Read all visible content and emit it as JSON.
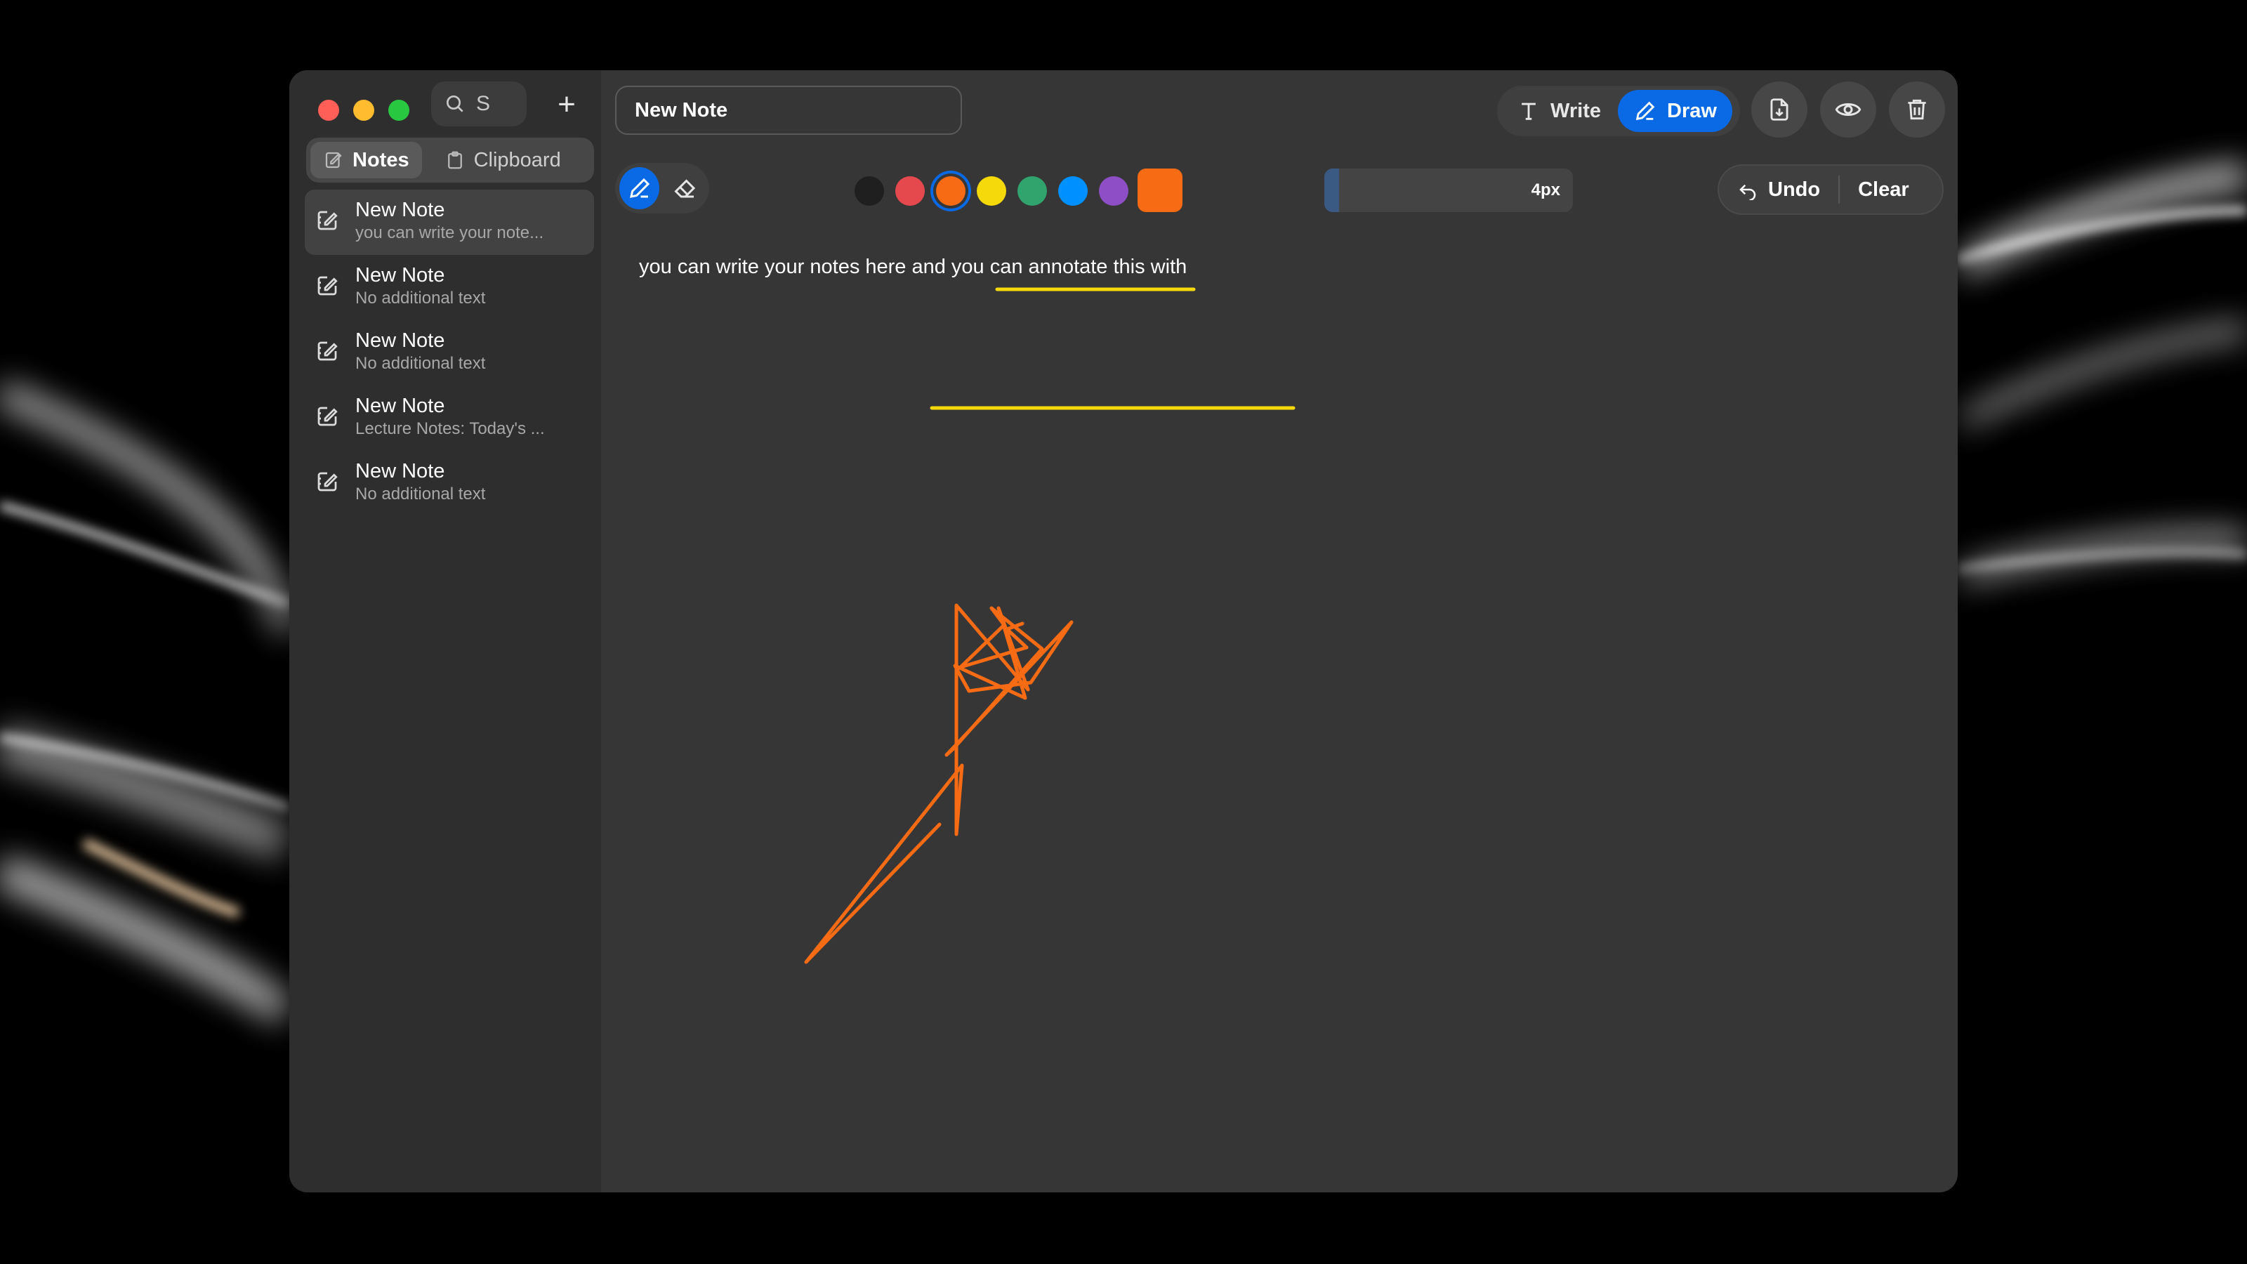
{
  "sidebar": {
    "search": {
      "value": "S"
    },
    "add_label": "+",
    "tabs": [
      {
        "label": "Notes",
        "icon": "notes-icon"
      },
      {
        "label": "Clipboard",
        "icon": "clipboard-icon"
      }
    ],
    "notes": [
      {
        "title": "New Note",
        "subtitle": "you can write your note..."
      },
      {
        "title": "New Note",
        "subtitle": "No additional text"
      },
      {
        "title": "New Note",
        "subtitle": "No additional text"
      },
      {
        "title": "New Note",
        "subtitle": "Lecture Notes: Today's ..."
      },
      {
        "title": "New Note",
        "subtitle": "No additional text"
      }
    ]
  },
  "editor": {
    "title": "New Note",
    "body_text": "you can write your notes here and you can annotate this with",
    "mode": {
      "write_label": "Write",
      "draw_label": "Draw",
      "active": "Draw"
    }
  },
  "toolbar": {
    "tools": [
      "pen-icon",
      "eraser-icon"
    ],
    "active_tool": "pen",
    "colors": [
      "#1f1f1f",
      "#e5484d",
      "#f76b15",
      "#f5d90a",
      "#30a46c",
      "#0090ff",
      "#8e4ec6"
    ],
    "selected_color": "#f76b15",
    "brush_size_label": "4px",
    "brush_size_fraction": 0.06,
    "undo_label": "Undo",
    "clear_label": "Clear"
  },
  "colors": {
    "accent": "#0a6ae6",
    "window_bg": "#363636",
    "sidebar_bg": "#2e2e2e",
    "highlight_yellow": "#f5d90a",
    "ink_orange": "#f76b15"
  }
}
